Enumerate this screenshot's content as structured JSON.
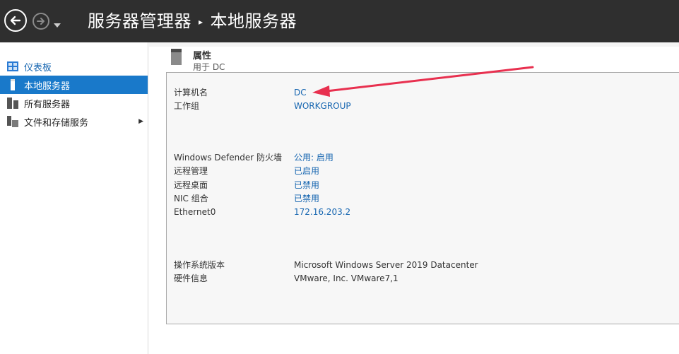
{
  "header": {
    "title": "服务器管理器",
    "subtitle": "本地服务器"
  },
  "sidebar": {
    "items": [
      {
        "label": "仪表板",
        "icon": "dashboard-icon"
      },
      {
        "label": "本地服务器",
        "icon": "server-icon"
      },
      {
        "label": "所有服务器",
        "icon": "servers-icon"
      },
      {
        "label": "文件和存储服务",
        "icon": "storage-icon"
      }
    ]
  },
  "properties": {
    "title": "属性",
    "subtitle": "用于 DC",
    "rows": [
      {
        "label": "计算机名",
        "value": "DC"
      },
      {
        "label": "工作组",
        "value": "WORKGROUP"
      },
      {
        "label": "Windows Defender 防火墙",
        "value": "公用: 启用"
      },
      {
        "label": "远程管理",
        "value": "已启用"
      },
      {
        "label": "远程桌面",
        "value": "已禁用"
      },
      {
        "label": "NIC 组合",
        "value": "已禁用"
      },
      {
        "label": "Ethernet0",
        "value": "172.16.203.2"
      },
      {
        "label": "操作系统版本",
        "value": "Microsoft Windows Server 2019 Datacenter"
      },
      {
        "label": "硬件信息",
        "value": "VMware, Inc. VMware7,1"
      }
    ]
  },
  "colors": {
    "accent": "#1979ca",
    "link": "#1565b0",
    "annotation": "#e8304f"
  }
}
